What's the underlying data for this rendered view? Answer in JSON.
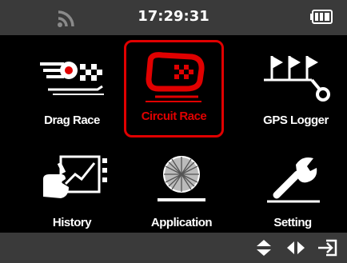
{
  "status": {
    "time": "17:29:31",
    "signal_icon": "signal-icon",
    "battery_icon": "battery-icon"
  },
  "menu": [
    {
      "label": "Drag Race",
      "icon": "drag-race-icon",
      "selected": false
    },
    {
      "label": "Circuit Race",
      "icon": "circuit-race-icon",
      "selected": true
    },
    {
      "label": "GPS Logger",
      "icon": "gps-logger-icon",
      "selected": false
    },
    {
      "label": "History",
      "icon": "history-icon",
      "selected": false
    },
    {
      "label": "Application",
      "icon": "application-icon",
      "selected": false
    },
    {
      "label": "Setting",
      "icon": "setting-icon",
      "selected": false
    }
  ],
  "navigation": {
    "up_down_icon": "up-down-arrows-icon",
    "left_right_icon": "left-right-arrows-icon",
    "enter_icon": "enter-icon"
  },
  "colors": {
    "bar_background": "#3a3a3a",
    "selection": "#e00000",
    "text": "#ffffff"
  }
}
